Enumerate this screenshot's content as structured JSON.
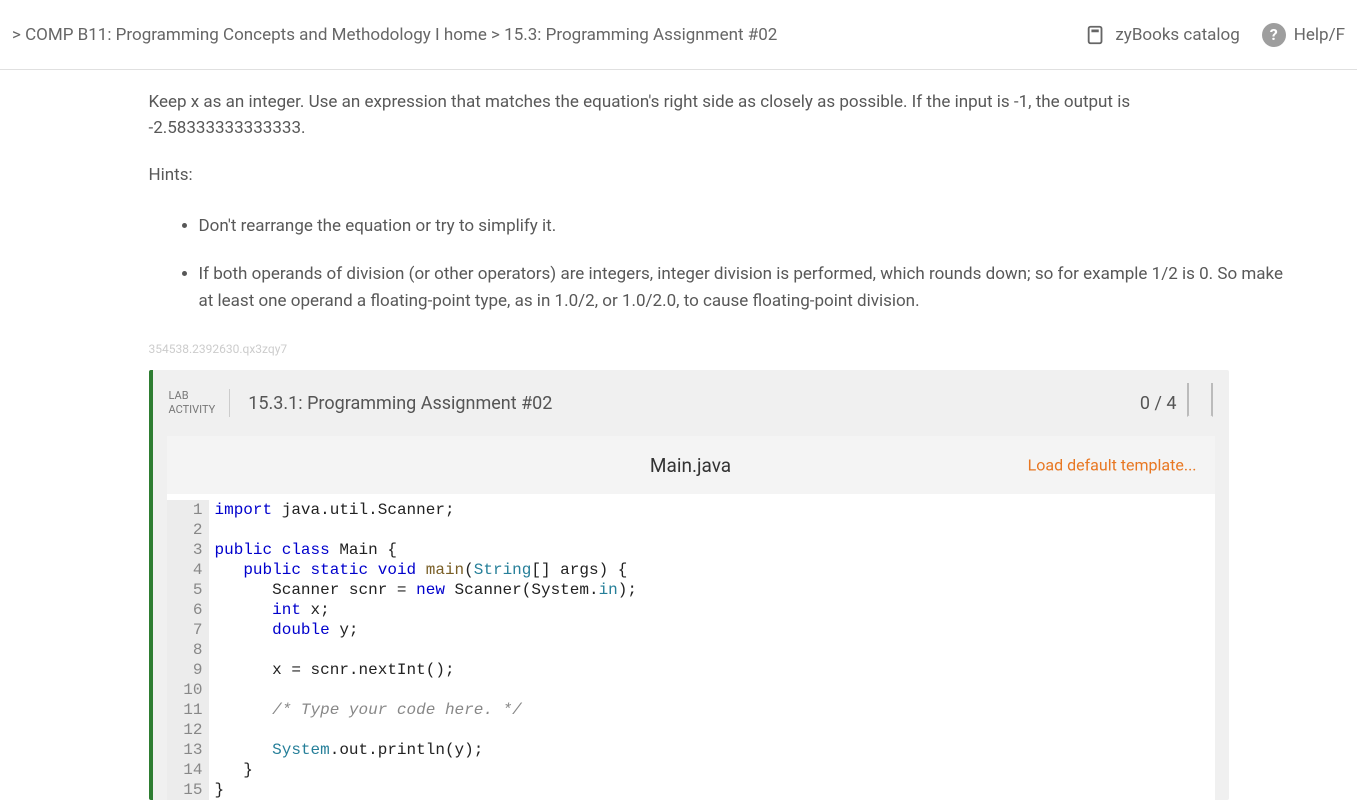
{
  "topbar": {
    "breadcrumb": " > COMP B11: Programming Concepts and Methodology I home > 15.3: Programming Assignment #02",
    "catalog": "zyBooks catalog",
    "help": "Help/F"
  },
  "instructions": {
    "para1": "Keep x as an integer. Use an expression that matches the equation's right side as closely as possible. If the input is -1, the output is -2.58333333333333.",
    "hints_label": "Hints:",
    "hints": [
      "Don't rearrange the equation or try to simplify it.",
      "If both operands of division (or other operators) are integers, integer division is performed, which rounds down; so for example 1/2 is 0. So make at least one operand a floating-point type, as in 1.0/2, or 1.0/2.0, to cause floating-point division."
    ]
  },
  "hash": "354538.2392630.qx3zqy7",
  "lab": {
    "label_line1": "LAB",
    "label_line2": "ACTIVITY",
    "title": "15.3.1: Programming Assignment #02",
    "score": "0 / 4",
    "filename": "Main.java",
    "load_template": "Load default template...",
    "code": [
      {
        "n": "1",
        "tokens": [
          {
            "t": "import ",
            "c": "kw"
          },
          {
            "t": "java.util.Scanner;",
            "c": ""
          }
        ]
      },
      {
        "n": "2",
        "tokens": [
          {
            "t": "",
            "c": ""
          }
        ]
      },
      {
        "n": "3",
        "tokens": [
          {
            "t": "public class ",
            "c": "kw"
          },
          {
            "t": "Main {",
            "c": ""
          }
        ]
      },
      {
        "n": "4",
        "tokens": [
          {
            "t": "   ",
            "c": ""
          },
          {
            "t": "public static void ",
            "c": "kw"
          },
          {
            "t": "main",
            "c": "fn"
          },
          {
            "t": "(",
            "c": ""
          },
          {
            "t": "String",
            "c": "typ"
          },
          {
            "t": "[] args) {",
            "c": ""
          }
        ]
      },
      {
        "n": "5",
        "tokens": [
          {
            "t": "      Scanner scnr = ",
            "c": ""
          },
          {
            "t": "new ",
            "c": "kw"
          },
          {
            "t": "Scanner(System.",
            "c": ""
          },
          {
            "t": "in",
            "c": "typ"
          },
          {
            "t": ");",
            "c": ""
          }
        ]
      },
      {
        "n": "6",
        "tokens": [
          {
            "t": "      ",
            "c": ""
          },
          {
            "t": "int ",
            "c": "kw"
          },
          {
            "t": "x;",
            "c": ""
          }
        ]
      },
      {
        "n": "7",
        "tokens": [
          {
            "t": "      ",
            "c": ""
          },
          {
            "t": "double ",
            "c": "kw"
          },
          {
            "t": "y;",
            "c": ""
          }
        ]
      },
      {
        "n": "8",
        "tokens": [
          {
            "t": "",
            "c": ""
          }
        ]
      },
      {
        "n": "9",
        "tokens": [
          {
            "t": "      x = scnr.nextInt();",
            "c": ""
          }
        ]
      },
      {
        "n": "10",
        "tokens": [
          {
            "t": "",
            "c": ""
          }
        ]
      },
      {
        "n": "11",
        "tokens": [
          {
            "t": "      ",
            "c": ""
          },
          {
            "t": "/* Type your code here. */",
            "c": "cmt"
          }
        ]
      },
      {
        "n": "12",
        "tokens": [
          {
            "t": "",
            "c": ""
          }
        ]
      },
      {
        "n": "13",
        "tokens": [
          {
            "t": "      ",
            "c": ""
          },
          {
            "t": "System",
            "c": "typ"
          },
          {
            "t": ".out.println(y);",
            "c": ""
          }
        ]
      },
      {
        "n": "14",
        "tokens": [
          {
            "t": "   }",
            "c": ""
          }
        ]
      },
      {
        "n": "15",
        "tokens": [
          {
            "t": "}",
            "c": ""
          }
        ]
      }
    ]
  }
}
